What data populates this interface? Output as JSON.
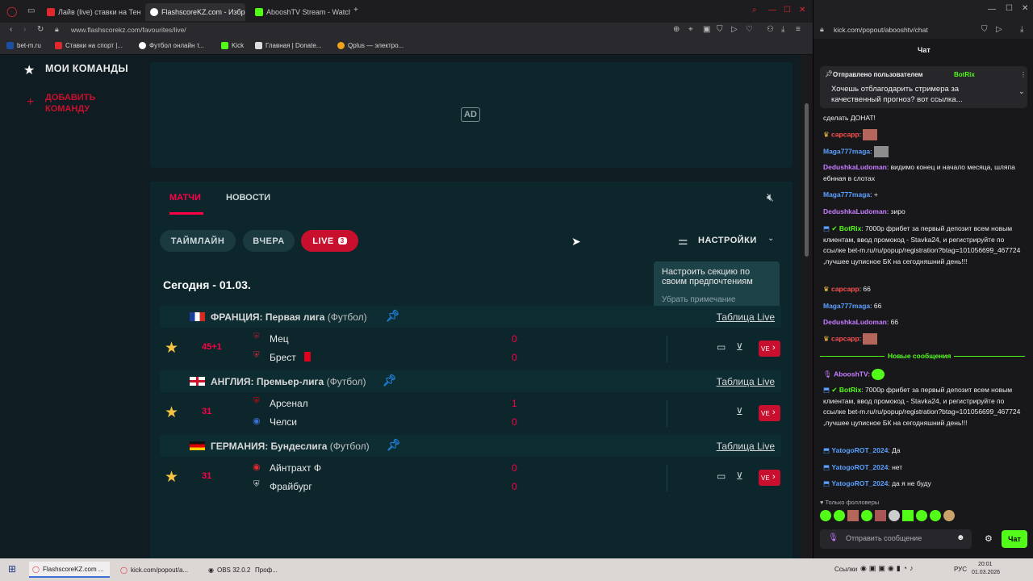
{
  "browser_left": {
    "tabs": [
      {
        "label": "Лайв (live) ставки на Тен",
        "color": "#e0282f"
      },
      {
        "label": "FlashscoreKZ.com - Избр",
        "color": "#ffffff"
      },
      {
        "label": "AbooshTV Stream - Watch",
        "color": "#53fc18"
      }
    ],
    "url": "www.flashscorekz.com/favourites/live/",
    "bookmarks": [
      "bet-m.ru",
      "Ставки на спорт |...",
      "Футбол онлайн т...",
      "Kick",
      "Главная | Donate...",
      "Qplus — электро..."
    ]
  },
  "sidebar": {
    "my_teams": "МОИ КОМАНДЫ",
    "add_team": "ДОБАВИТЬ КОМАНДУ"
  },
  "ad": {
    "label": "AD"
  },
  "tabs": {
    "matches": "МАТЧИ",
    "news": "НОВОСТИ"
  },
  "filters": {
    "timeline": "ТАЙМЛАЙН",
    "yesterday": "ВЧЕРА",
    "live": "LIVE",
    "live_count": "3",
    "settings": "НАСТРОЙКИ"
  },
  "tooltip": {
    "text": "Настроить секцию по своим предпочтениям",
    "dismiss": "Убрать примечание"
  },
  "date_header": "Сегодня - 01.03.",
  "leagues": [
    {
      "name": "ФРАНЦИЯ: Первая лига",
      "sport": "(Футбол)",
      "table_link": "Таблица Live",
      "match": {
        "time": "45+1",
        "home": "Мец",
        "away": "Брест",
        "home_score": "0",
        "away_score": "0",
        "away_redcard": true
      }
    },
    {
      "name": "АНГЛИЯ: Премьер-лига",
      "sport": "(Футбол)",
      "table_link": "Таблица Live",
      "match": {
        "time": "31",
        "home": "Арсенал",
        "away": "Челси",
        "home_score": "1",
        "away_score": "0",
        "away_redcard": false
      }
    },
    {
      "name": "ГЕРМАНИЯ: Бундеслига",
      "sport": "(Футбол)",
      "table_link": "Таблица Live",
      "match": {
        "time": "31",
        "home": "Айнтрахт Ф",
        "away": "Фрайбург",
        "home_score": "0",
        "away_score": "0",
        "away_redcard": false
      }
    }
  ],
  "live_badge": "VE",
  "browser_right": {
    "url": "kick.com/popout/abooshtv/chat",
    "chat_title": "Чат"
  },
  "pinned": {
    "label": "Отправлено пользователем",
    "user": "BotRix",
    "text": "Хочешь отблагодарить стримера за качественный прогноз? вот ссылка..."
  },
  "chat": [
    {
      "user": "",
      "text": "сделать ДОНАТ!",
      "color": "#efeff1"
    },
    {
      "user": "сарсарр",
      "text": "",
      "color": "#ff4f4f"
    },
    {
      "user": "Maga777maga",
      "text": "",
      "color": "#5aa0ff"
    },
    {
      "user": "DedushkaLudoman",
      "text": "видимо конец и начало месяца, шляпа ебнная в слотах",
      "color": "#c77dff"
    },
    {
      "user": "Maga777maga",
      "text": "+",
      "color": "#5aa0ff"
    },
    {
      "user": "DedushkaLudoman",
      "text": "зиро",
      "color": "#c77dff"
    },
    {
      "user": "BotRix",
      "text": "7000р фрибет за первый депозит всем новым клиентам, ввод промокод - Stavka24, и регистрируйте по ссылке bet-m.ru/ru/popup/registration?btag=101056699_467724 ,лучшее цуписное БК на сегодняшний день!!!",
      "color": "#53fc18"
    },
    {
      "user": "сарсарр",
      "text": "66",
      "color": "#ff4f4f"
    },
    {
      "user": "Maga777maga",
      "text": "66",
      "color": "#5aa0ff"
    },
    {
      "user": "DedushkaLudoman",
      "text": "66",
      "color": "#c77dff"
    },
    {
      "user": "сарсарр",
      "text": "",
      "color": "#ff4f4f"
    }
  ],
  "new_messages": "Новые сообщения",
  "chat2": [
    {
      "user": "AbooshTV",
      "text": "",
      "color": "#c77dff"
    },
    {
      "user": "BotRix",
      "text": "7000р фрибет за первый депозит всем новым клиентам, ввод промокод - Stavka24, и регистрируйте по ссылке bet-m.ru/ru/popup/registration?btag=101056699_467724 ,лучшее цуписное БК на сегодняшний день!!!",
      "color": "#53fc18"
    },
    {
      "user": "YatogoROT_2024",
      "text": "Да",
      "color": "#5aa0ff"
    },
    {
      "user": "YatogoROT_2024",
      "text": "нет",
      "color": "#5aa0ff"
    },
    {
      "user": "YatogoROT_2024",
      "text": "да я не буду",
      "color": "#5aa0ff"
    }
  ],
  "followers_only": "Только фолловеры",
  "send_placeholder": "Отправить сообщение",
  "chat_button": "Чат",
  "taskbar": {
    "items": [
      "FlashscoreKZ.com ...",
      "kick.com/popout/a...",
      "OBS 32.0.2",
      "Проф..."
    ],
    "links": "Ссылки",
    "lang": "РУС",
    "time": "20:01",
    "date": "01.03.2026"
  }
}
